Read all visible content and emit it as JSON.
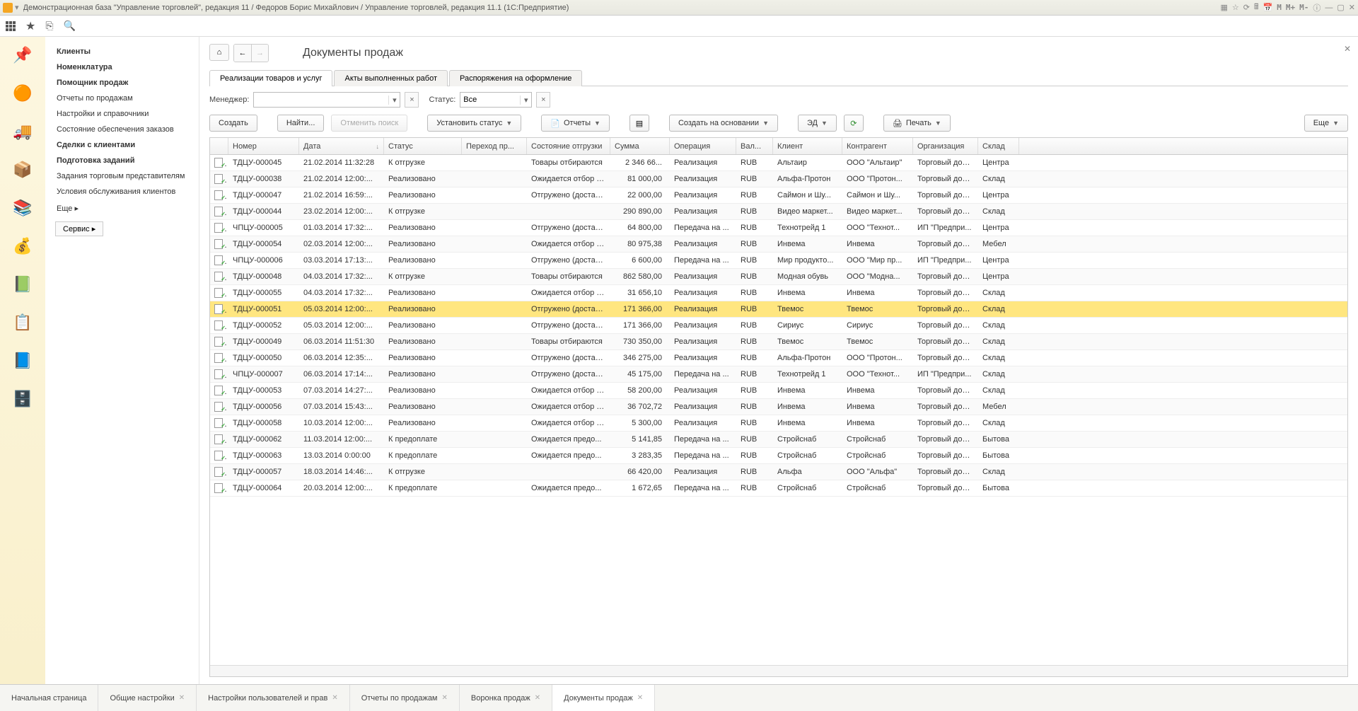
{
  "app": {
    "title": "Демонстрационная база \"Управление торговлей\", редакция 11 / Федоров Борис Михайлович / Управление торговлей, редакция 11.1  (1С:Предприятие)",
    "sysbtns": [
      "M",
      "M+",
      "M-"
    ]
  },
  "nav": {
    "items": [
      {
        "label": "Клиенты",
        "bold": true
      },
      {
        "label": "Номенклатура",
        "bold": true
      },
      {
        "label": "Помощник продаж",
        "bold": true
      },
      {
        "label": "Отчеты по продажам",
        "bold": false
      },
      {
        "label": "Настройки и справочники",
        "bold": false
      },
      {
        "label": "Состояние обеспечения заказов",
        "bold": false
      },
      {
        "label": "Сделки с клиентами",
        "bold": true
      },
      {
        "label": "Подготовка заданий",
        "bold": true
      },
      {
        "label": "Задания торговым представителям",
        "bold": false
      },
      {
        "label": "Условия обслуживания клиентов",
        "bold": false
      }
    ],
    "more": "Еще ▸",
    "service": "Сервис ▸"
  },
  "leftIcons": [
    "📌",
    "🟠",
    "🚚",
    "📦",
    "📚",
    "💰",
    "📗",
    "📋",
    "📘",
    "🗄️"
  ],
  "page": {
    "title": "Документы продаж",
    "tabs": [
      {
        "label": "Реализации товаров и услуг",
        "active": true
      },
      {
        "label": "Акты выполненных работ",
        "active": false
      },
      {
        "label": "Распоряжения на оформление",
        "active": false
      }
    ],
    "filters": {
      "manager_label": "Менеджер:",
      "manager_value": "",
      "status_label": "Статус:",
      "status_value": "Все"
    },
    "buttons": {
      "create": "Создать",
      "find": "Найти...",
      "cancel_find": "Отменить поиск",
      "set_status": "Установить статус",
      "reports": "Отчеты",
      "create_based": "Создать на основании",
      "ed": "ЭД",
      "print": "Печать",
      "more": "Еще"
    },
    "columns": [
      "",
      "Номер",
      "Дата",
      "Статус",
      "Переход пр...",
      "Состояние отгрузки",
      "Сумма",
      "Операция",
      "Вал...",
      "Клиент",
      "Контрагент",
      "Организация",
      "Склад"
    ],
    "sort_col": 2,
    "rows": [
      {
        "n": "ТДЦУ-000045",
        "d": "21.02.2014 11:32:28",
        "st": "К отгрузке",
        "sh": "Товары отбираются",
        "sum": "2 346 66...",
        "op": "Реализация",
        "cur": "RUB",
        "cl": "Альтаир",
        "ka": "ООО \"Альтаир\"",
        "org": "Торговый дом...",
        "wh": "Центра"
      },
      {
        "n": "ТДЦУ-000038",
        "d": "21.02.2014 12:00:...",
        "st": "Реализовано",
        "sh": "Ожидается отбор т...",
        "sum": "81 000,00",
        "op": "Реализация",
        "cur": "RUB",
        "cl": "Альфа-Протон",
        "ka": "ООО \"Протон...",
        "org": "Торговый дом...",
        "wh": "Склад"
      },
      {
        "n": "ТДЦУ-000047",
        "d": "21.02.2014 16:59:...",
        "st": "Реализовано",
        "sh": "Отгружено (достав...",
        "sum": "22 000,00",
        "op": "Реализация",
        "cur": "RUB",
        "cl": "Саймон и Шу...",
        "ka": "Саймон и Шу...",
        "org": "Торговый дом...",
        "wh": "Центра"
      },
      {
        "n": "ТДЦУ-000044",
        "d": "23.02.2014 12:00:...",
        "st": "К отгрузке",
        "sh": "",
        "sum": "290 890,00",
        "op": "Реализация",
        "cur": "RUB",
        "cl": "Видео маркет...",
        "ka": "Видео маркет...",
        "org": "Торговый дом...",
        "wh": "Склад"
      },
      {
        "n": "ЧПЦУ-000005",
        "d": "01.03.2014 17:32:...",
        "st": "Реализовано",
        "sh": "Отгружено (достав...",
        "sum": "64 800,00",
        "op": "Передача на ...",
        "cur": "RUB",
        "cl": "Технотрейд 1",
        "ka": "ООО \"Технот...",
        "org": "ИП \"Предпри...",
        "wh": "Центра"
      },
      {
        "n": "ТДЦУ-000054",
        "d": "02.03.2014 12:00:...",
        "st": "Реализовано",
        "sh": "Ожидается отбор т...",
        "sum": "80 975,38",
        "op": "Реализация",
        "cur": "RUB",
        "cl": "Инвема",
        "ka": "Инвема",
        "org": "Торговый дом...",
        "wh": "Мебел"
      },
      {
        "n": "ЧПЦУ-000006",
        "d": "03.03.2014 17:13:...",
        "st": "Реализовано",
        "sh": "Отгружено (достав...",
        "sum": "6 600,00",
        "op": "Передача на ...",
        "cur": "RUB",
        "cl": "Мир продукто...",
        "ka": "ООО \"Мир пр...",
        "org": "ИП \"Предпри...",
        "wh": "Центра"
      },
      {
        "n": "ТДЦУ-000048",
        "d": "04.03.2014 17:32:...",
        "st": "К отгрузке",
        "sh": "Товары отбираются",
        "sum": "862 580,00",
        "op": "Реализация",
        "cur": "RUB",
        "cl": "Модная обувь",
        "ka": "ООО \"Модна...",
        "org": "Торговый дом...",
        "wh": "Центра"
      },
      {
        "n": "ТДЦУ-000055",
        "d": "04.03.2014 17:32:...",
        "st": "Реализовано",
        "sh": "Ожидается отбор т...",
        "sum": "31 656,10",
        "op": "Реализация",
        "cur": "RUB",
        "cl": "Инвема",
        "ka": "Инвема",
        "org": "Торговый дом...",
        "wh": "Склад"
      },
      {
        "n": "ТДЦУ-000051",
        "d": "05.03.2014 12:00:...",
        "st": "Реализовано",
        "sh": "Отгружено (достав...",
        "sum": "171 366,00",
        "op": "Реализация",
        "cur": "RUB",
        "cl": "Твемос",
        "ka": "Твемос",
        "org": "Торговый дом...",
        "wh": "Склад",
        "sel": true
      },
      {
        "n": "ТДЦУ-000052",
        "d": "05.03.2014 12:00:...",
        "st": "Реализовано",
        "sh": "Отгружено (достав...",
        "sum": "171 366,00",
        "op": "Реализация",
        "cur": "RUB",
        "cl": "Сириус",
        "ka": "Сириус",
        "org": "Торговый дом...",
        "wh": "Склад"
      },
      {
        "n": "ТДЦУ-000049",
        "d": "06.03.2014 11:51:30",
        "st": "Реализовано",
        "sh": "Товары отбираются",
        "sum": "730 350,00",
        "op": "Реализация",
        "cur": "RUB",
        "cl": "Твемос",
        "ka": "Твемос",
        "org": "Торговый дом...",
        "wh": "Склад"
      },
      {
        "n": "ТДЦУ-000050",
        "d": "06.03.2014 12:35:...",
        "st": "Реализовано",
        "sh": "Отгружено (достав...",
        "sum": "346 275,00",
        "op": "Реализация",
        "cur": "RUB",
        "cl": "Альфа-Протон",
        "ka": "ООО \"Протон...",
        "org": "Торговый дом...",
        "wh": "Склад"
      },
      {
        "n": "ЧПЦУ-000007",
        "d": "06.03.2014 17:14:...",
        "st": "Реализовано",
        "sh": "Отгружено (достав...",
        "sum": "45 175,00",
        "op": "Передача на ...",
        "cur": "RUB",
        "cl": "Технотрейд 1",
        "ka": "ООО \"Технот...",
        "org": "ИП \"Предпри...",
        "wh": "Склад"
      },
      {
        "n": "ТДЦУ-000053",
        "d": "07.03.2014 14:27:...",
        "st": "Реализовано",
        "sh": "Ожидается отбор т...",
        "sum": "58 200,00",
        "op": "Реализация",
        "cur": "RUB",
        "cl": "Инвема",
        "ka": "Инвема",
        "org": "Торговый дом...",
        "wh": "Склад"
      },
      {
        "n": "ТДЦУ-000056",
        "d": "07.03.2014 15:43:...",
        "st": "Реализовано",
        "sh": "Ожидается отбор т...",
        "sum": "36 702,72",
        "op": "Реализация",
        "cur": "RUB",
        "cl": "Инвема",
        "ka": "Инвема",
        "org": "Торговый дом...",
        "wh": "Мебел"
      },
      {
        "n": "ТДЦУ-000058",
        "d": "10.03.2014 12:00:...",
        "st": "Реализовано",
        "sh": "Ожидается отбор т...",
        "sum": "5 300,00",
        "op": "Реализация",
        "cur": "RUB",
        "cl": "Инвема",
        "ka": "Инвема",
        "org": "Торговый дом...",
        "wh": "Склад"
      },
      {
        "n": "ТДЦУ-000062",
        "d": "11.03.2014 12:00:...",
        "st": "К предоплате",
        "sh": "Ожидается предо...",
        "sum": "5 141,85",
        "op": "Передача на ...",
        "cur": "RUB",
        "cl": "Стройснаб",
        "ka": "Стройснаб",
        "org": "Торговый дом...",
        "wh": "Бытова"
      },
      {
        "n": "ТДЦУ-000063",
        "d": "13.03.2014 0:00:00",
        "st": "К предоплате",
        "sh": "Ожидается предо...",
        "sum": "3 283,35",
        "op": "Передача на ...",
        "cur": "RUB",
        "cl": "Стройснаб",
        "ka": "Стройснаб",
        "org": "Торговый дом...",
        "wh": "Бытова"
      },
      {
        "n": "ТДЦУ-000057",
        "d": "18.03.2014 14:46:...",
        "st": "К отгрузке",
        "sh": "",
        "sum": "66 420,00",
        "op": "Реализация",
        "cur": "RUB",
        "cl": "Альфа",
        "ka": "ООО \"Альфа\"",
        "org": "Торговый дом...",
        "wh": "Склад"
      },
      {
        "n": "ТДЦУ-000064",
        "d": "20.03.2014 12:00:...",
        "st": "К предоплате",
        "sh": "Ожидается предо...",
        "sum": "1 672,65",
        "op": "Передача на ...",
        "cur": "RUB",
        "cl": "Стройснаб",
        "ka": "Стройснаб",
        "org": "Торговый дом...",
        "wh": "Бытова"
      }
    ]
  },
  "bottomTabs": [
    {
      "label": "Начальная страница",
      "closable": false
    },
    {
      "label": "Общие настройки",
      "closable": true
    },
    {
      "label": "Настройки пользователей и прав",
      "closable": true
    },
    {
      "label": "Отчеты по продажам",
      "closable": true
    },
    {
      "label": "Воронка продаж",
      "closable": true
    },
    {
      "label": "Документы продаж",
      "closable": true,
      "active": true
    }
  ]
}
